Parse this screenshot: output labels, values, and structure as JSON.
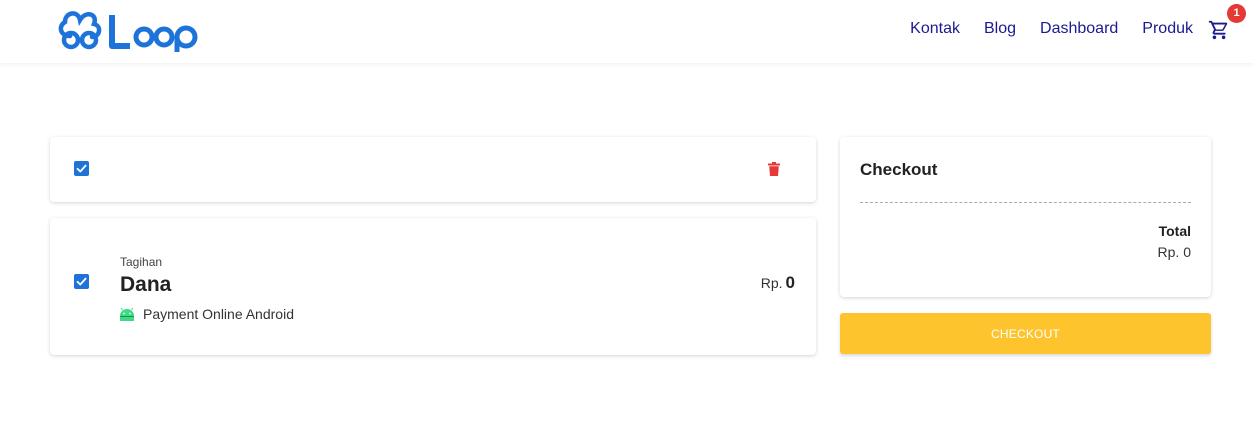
{
  "brand": {
    "logo_text": "Loop",
    "logo_color": "#1e73d8"
  },
  "nav": {
    "items": [
      {
        "label": "Kontak"
      },
      {
        "label": "Blog"
      },
      {
        "label": "Dashboard"
      },
      {
        "label": "Produk"
      }
    ],
    "link_color": "#1b1a8f",
    "cart_icon": "shopping-cart-icon",
    "cart_count": "1",
    "badge_color": "#e53935"
  },
  "cart": {
    "select_all_checked": true,
    "delete_icon": "trash-icon",
    "delete_color": "#e53935",
    "items": [
      {
        "checked": true,
        "category": "Tagihan",
        "name": "Dana",
        "platform_icon": "android-icon",
        "platform": "Payment Online Android",
        "price_prefix": "Rp.",
        "price": "0"
      }
    ]
  },
  "checkout": {
    "title": "Checkout",
    "total_label": "Total",
    "total_value": "Rp. 0",
    "button_label": "CHECKOUT",
    "button_color": "#fec42d"
  }
}
